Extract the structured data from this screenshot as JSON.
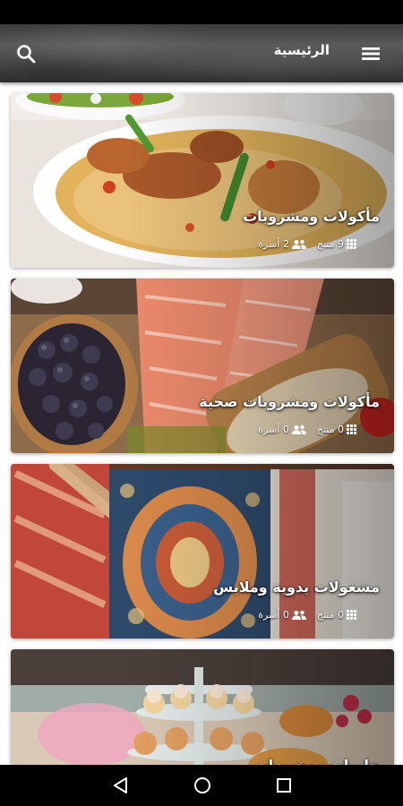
{
  "app_bar": {
    "title": "الرئيسية",
    "search_icon": "search-icon",
    "menu_icon": "hamburger-menu-icon"
  },
  "categories": [
    {
      "title": "مأكولات ومشروبات",
      "products_label": "9 منتج",
      "families_label": "2 أسرة",
      "image": "rice-and-chicken-dish"
    },
    {
      "title": "مأكولات ومشروبات صحية",
      "products_label": "0 منتج",
      "families_label": "0 أسرة",
      "image": "salmon-blueberries-oats"
    },
    {
      "title": "مشغولات يدوية وملابس",
      "products_label": "0 منتج",
      "families_label": "0 أسرة",
      "image": "handmade-fabrics-clothes"
    },
    {
      "title": "حلويات ومخبوزات",
      "products_label": "",
      "families_label": "",
      "image": "cupcakes-and-desserts"
    }
  ],
  "nav": {
    "back_icon": "back-triangle-icon",
    "home_icon": "home-circle-icon",
    "recents_icon": "recents-square-icon"
  },
  "colors": {
    "app_bar": "#4a4a4a",
    "text_on_image": "#ffffff",
    "system_bars": "#000000"
  }
}
